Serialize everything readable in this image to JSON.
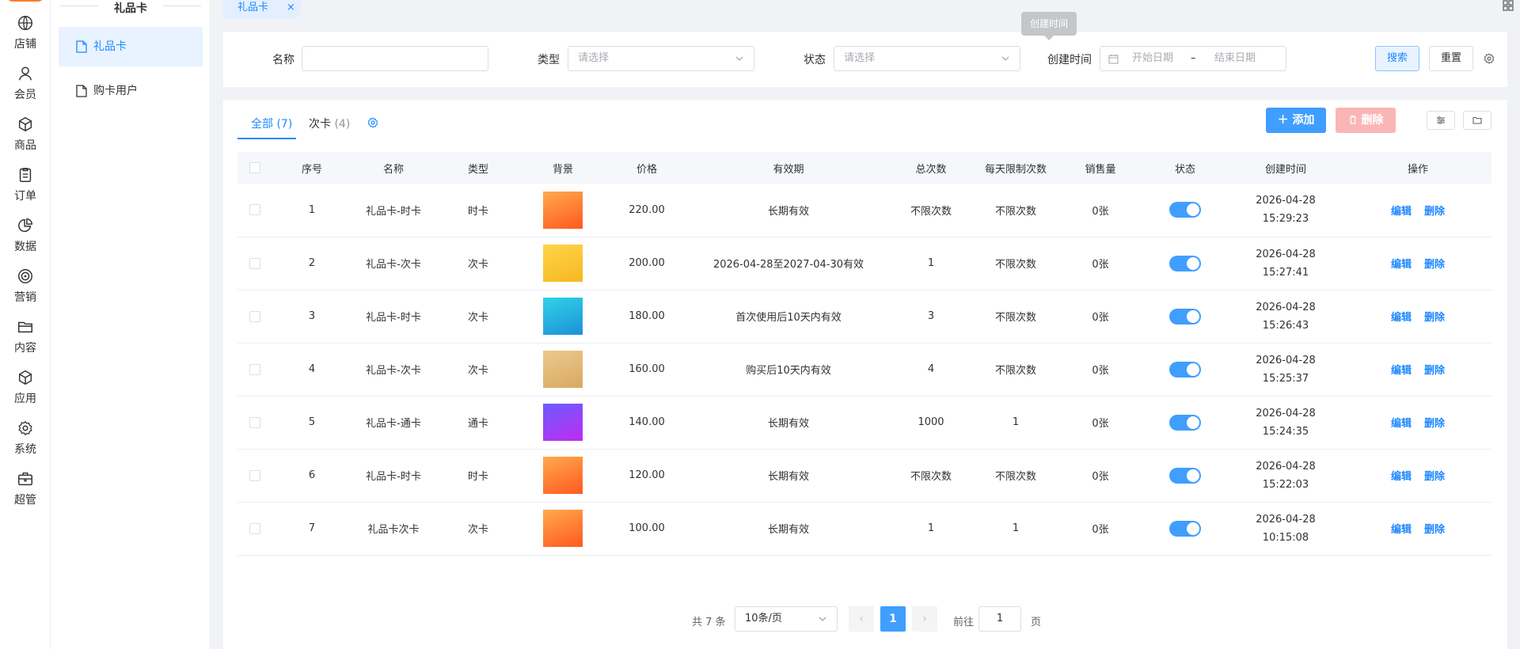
{
  "nav": {
    "items": [
      {
        "label": "店铺",
        "icon": "store-icon"
      },
      {
        "label": "会员",
        "icon": "member-icon"
      },
      {
        "label": "商品",
        "icon": "goods-icon"
      },
      {
        "label": "订单",
        "icon": "order-icon"
      },
      {
        "label": "数据",
        "icon": "data-icon"
      },
      {
        "label": "营销",
        "icon": "marketing-icon"
      },
      {
        "label": "内容",
        "icon": "content-icon"
      },
      {
        "label": "应用",
        "icon": "app-icon"
      },
      {
        "label": "系统",
        "icon": "system-icon"
      },
      {
        "label": "超管",
        "icon": "admin-icon"
      }
    ]
  },
  "submenu": {
    "title": "礼品卡",
    "items": [
      {
        "label": "礼品卡",
        "active": true
      },
      {
        "label": "购卡用户",
        "active": false
      }
    ]
  },
  "page_tab": {
    "label": "礼品卡",
    "close": "×"
  },
  "filter": {
    "name_label": "名称",
    "name_value": "",
    "type_label": "类型",
    "type_placeholder": "请选择",
    "status_label": "状态",
    "status_placeholder": "请选择",
    "created_label": "创建时间",
    "start_placeholder": "开始日期",
    "range_sep": "–",
    "end_placeholder": "结束日期",
    "search_label": "搜索",
    "reset_label": "重置",
    "tooltip": "创建时间"
  },
  "tabs": [
    {
      "label": "全部",
      "count": "(7)",
      "active": true
    },
    {
      "label": "次卡",
      "count": "(4)",
      "active": false
    }
  ],
  "toolbar": {
    "add_label": "添加",
    "delete_label": "删除"
  },
  "table": {
    "headers": [
      "序号",
      "名称",
      "类型",
      "背景",
      "价格",
      "有效期",
      "总次数",
      "每天限制次数",
      "销售量",
      "状态",
      "创建时间",
      "操作"
    ],
    "edit_label": "编辑",
    "delete_label": "删除",
    "rows": [
      {
        "no": "1",
        "name": "礼品卡-时卡",
        "type": "时卡",
        "bg": "#ff7a2a",
        "price": "220.00",
        "validity": "长期有效",
        "total": "不限次数",
        "daily": "不限次数",
        "sales": "0张",
        "enabled": true,
        "date": "2026-04-28",
        "time": "15:29:23"
      },
      {
        "no": "2",
        "name": "礼品卡-次卡",
        "type": "次卡",
        "bg": "#f8c93a",
        "price": "200.00",
        "validity": "2026-04-28至2027-04-30有效",
        "total": "1",
        "daily": "不限次数",
        "sales": "0张",
        "enabled": true,
        "date": "2026-04-28",
        "time": "15:27:41"
      },
      {
        "no": "3",
        "name": "礼品卡-时卡",
        "type": "次卡",
        "bg": "#29b6e0",
        "price": "180.00",
        "validity": "首次使用后10天内有效",
        "total": "3",
        "daily": "不限次数",
        "sales": "0张",
        "enabled": true,
        "date": "2026-04-28",
        "time": "15:26:43"
      },
      {
        "no": "4",
        "name": "礼品卡-次卡",
        "type": "次卡",
        "bg": "#e3b97a",
        "price": "160.00",
        "validity": "购买后10天内有效",
        "total": "4",
        "daily": "不限次数",
        "sales": "0张",
        "enabled": true,
        "date": "2026-04-28",
        "time": "15:25:37"
      },
      {
        "no": "5",
        "name": "礼品卡-通卡",
        "type": "通卡",
        "bg": "#9a3df5",
        "price": "140.00",
        "validity": "长期有效",
        "total": "1000",
        "daily": "1",
        "sales": "0张",
        "enabled": true,
        "date": "2026-04-28",
        "time": "15:24:35"
      },
      {
        "no": "6",
        "name": "礼品卡-时卡",
        "type": "时卡",
        "bg": "#ff7a2a",
        "price": "120.00",
        "validity": "长期有效",
        "total": "不限次数",
        "daily": "不限次数",
        "sales": "0张",
        "enabled": true,
        "date": "2026-04-28",
        "time": "15:22:03"
      },
      {
        "no": "7",
        "name": "礼品卡次卡",
        "type": "次卡",
        "bg": "#ff7a2a",
        "price": "100.00",
        "validity": "长期有效",
        "total": "1",
        "daily": "1",
        "sales": "0张",
        "enabled": true,
        "date": "2026-04-28",
        "time": "10:15:08"
      }
    ]
  },
  "pagination": {
    "total_text": "共 7 条",
    "page_size": "10条/页",
    "prev": "‹",
    "current": "1",
    "next": "›",
    "goto_label": "前往",
    "goto_value": "1",
    "page_unit": "页"
  },
  "colors": {
    "accent": "#1e88ff",
    "primary_btn": "#409eff",
    "danger_disabled": "#fab6b6"
  }
}
